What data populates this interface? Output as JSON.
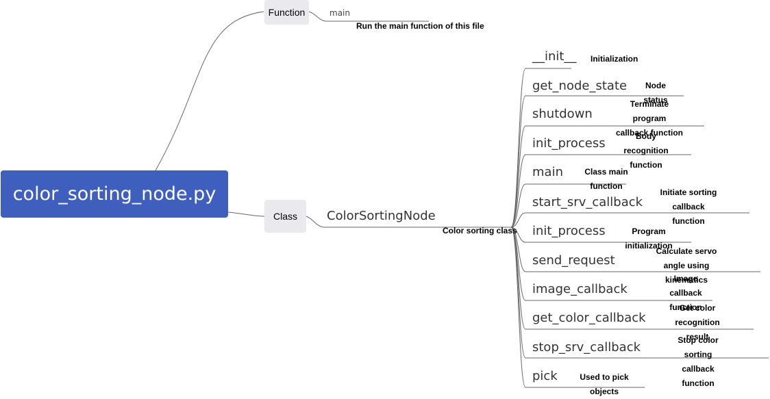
{
  "root": {
    "label": "color_sorting_node.py"
  },
  "function_branch": {
    "label": "Function",
    "item": {
      "name": "main",
      "note": "Run the main function of this file"
    }
  },
  "class_branch": {
    "label": "Class",
    "class_name": "ColorSortingNode",
    "class_note": "Color sorting class",
    "methods": [
      {
        "name": "__init__",
        "note": "Initialization"
      },
      {
        "name": "get_node_state",
        "note": "Node status"
      },
      {
        "name": "shutdown",
        "note": "Terminate program\ncallback function"
      },
      {
        "name": "init_process",
        "note": "Body recognition\nfunction"
      },
      {
        "name": "main",
        "note": "Class main function"
      },
      {
        "name": "start_srv_callback",
        "note": "Initiate sorting\ncallback function"
      },
      {
        "name": "init_process",
        "note": "Program initialization"
      },
      {
        "name": "send_request",
        "note": "Calculate servo\nangle using kinematics"
      },
      {
        "name": "image_callback",
        "note": "Image\ncallback function"
      },
      {
        "name": "get_color_callback",
        "note": "Get color\nrecognition result"
      },
      {
        "name": "stop_srv_callback",
        "note": "Stop color sorting\ncallback function"
      },
      {
        "name": "pick",
        "note": "Used to pick objects"
      }
    ]
  }
}
